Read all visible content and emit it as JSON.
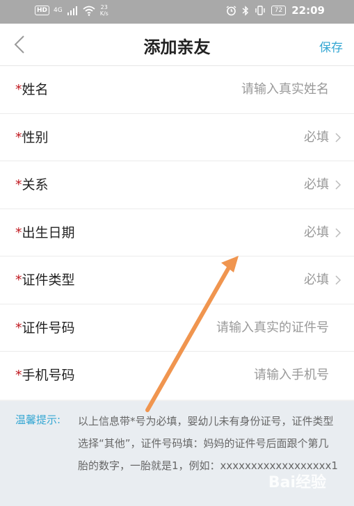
{
  "status_bar": {
    "hd": "HD",
    "network": "4G",
    "speed_value": "23",
    "speed_unit": "K/s",
    "battery": "72",
    "time": "22:09"
  },
  "header": {
    "title": "添加亲友",
    "save_label": "保存"
  },
  "form": {
    "required_mark": "*",
    "fields": [
      {
        "label": "姓名",
        "value": "请输入真实姓名"
      },
      {
        "label": "性别",
        "value": "必填"
      },
      {
        "label": "关系",
        "value": "必填"
      },
      {
        "label": "出生日期",
        "value": "必填"
      },
      {
        "label": "证件类型",
        "value": "必填"
      },
      {
        "label": "证件号码",
        "value": "请输入真实的证件号"
      },
      {
        "label": "手机号码",
        "value": "请输入手机号"
      }
    ]
  },
  "tip": {
    "label": "温馨提示:",
    "text": "以上信息带*号为必填，婴幼儿未有身份证号，证件类型选择“其他”，证件号码填：妈妈的证件号后面跟个第几胎的数字，一胎就是1，例如：xxxxxxxxxxxxxxxxxx1"
  },
  "watermark": "Bai经验",
  "colors": {
    "accent": "#35a7d3",
    "required": "#c0181f",
    "annotation_arrow": "#f0954f"
  }
}
